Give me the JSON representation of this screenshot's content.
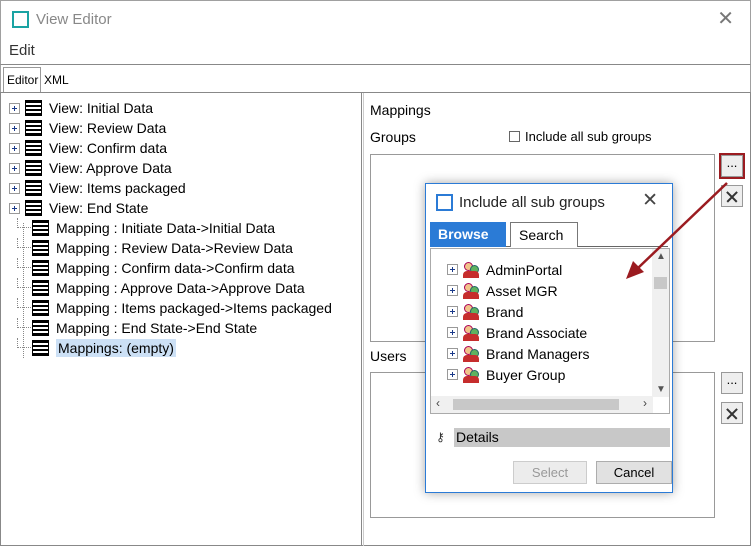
{
  "window": {
    "title": "View Editor",
    "close_glyph": "✕"
  },
  "menu": {
    "edit": "Edit"
  },
  "tabs": {
    "editor": "Editor",
    "xml": "XML"
  },
  "tree": {
    "views": [
      {
        "label": "View: Initial Data"
      },
      {
        "label": "View: Review Data"
      },
      {
        "label": "View: Confirm data"
      },
      {
        "label": "View: Approve Data"
      },
      {
        "label": "View: Items packaged"
      },
      {
        "label": "View: End State"
      }
    ],
    "mappings": [
      {
        "label": "Mapping : Initiate Data->Initial Data"
      },
      {
        "label": "Mapping : Review Data->Review Data"
      },
      {
        "label": "Mapping : Confirm data->Confirm data"
      },
      {
        "label": "Mapping : Approve Data->Approve Data"
      },
      {
        "label": "Mapping : Items packaged->Items packaged"
      },
      {
        "label": "Mapping : End State->End State"
      },
      {
        "label": "Mappings: (empty)"
      }
    ]
  },
  "right": {
    "mappings_label": "Mappings",
    "groups_label": "Groups",
    "include_all_label": "Include all sub groups",
    "users_label": "Users",
    "ellipsis": "..."
  },
  "dialog": {
    "title": "Include all sub groups",
    "close_glyph": "✕",
    "tab_browse": "Browse",
    "tab_search": "Search",
    "groups": [
      {
        "label": "AdminPortal"
      },
      {
        "label": "Asset MGR"
      },
      {
        "label": "Brand"
      },
      {
        "label": "Brand Associate"
      },
      {
        "label": "Brand Managers"
      },
      {
        "label": "Buyer Group"
      }
    ],
    "details": "Details",
    "select": "Select",
    "cancel": "Cancel"
  },
  "colors": {
    "accent": "#2b7bd6",
    "highlight": "#9b1b20",
    "selection": "#cce0f5"
  },
  "icons": {
    "app": "app-icon",
    "view": "document-list-icon",
    "group": "group-users-icon",
    "details": "key-icon",
    "remove": "cross-icon"
  }
}
